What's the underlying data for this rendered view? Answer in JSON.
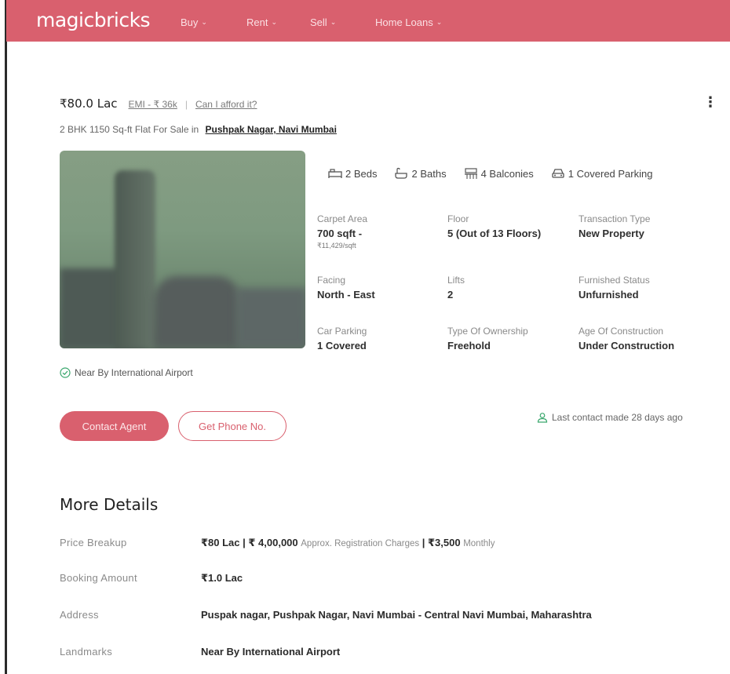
{
  "header": {
    "logo": "magicbricks",
    "nav": [
      {
        "label": "Buy"
      },
      {
        "label": "Rent"
      },
      {
        "label": "Sell"
      },
      {
        "label": "Home Loans"
      }
    ]
  },
  "listing": {
    "price": "₹80.0 Lac",
    "emi_link": "EMI - ₹ 36k",
    "separator": "|",
    "afford_link": "Can I afford it?",
    "subtitle_prefix": "2 BHK 1150 Sq-ft Flat For Sale in",
    "locality_link": "Pushpak Nagar, Navi Mumbai",
    "amenities": [
      {
        "icon": "bed-icon",
        "label": "2 Beds"
      },
      {
        "icon": "bath-icon",
        "label": "2 Baths"
      },
      {
        "icon": "balcony-icon",
        "label": "4 Balconies"
      },
      {
        "icon": "car-icon",
        "label": "1 Covered Parking"
      }
    ],
    "details": [
      {
        "label": "Carpet Area",
        "value": "700 sqft -",
        "sub": "₹11,429/sqft"
      },
      {
        "label": "Floor",
        "value": "5 (Out of 13 Floors)"
      },
      {
        "label": "Transaction Type",
        "value": "New Property"
      },
      {
        "label": "Facing",
        "value": "North - East"
      },
      {
        "label": "Lifts",
        "value": "2"
      },
      {
        "label": "Furnished Status",
        "value": "Unfurnished"
      },
      {
        "label": "Car Parking",
        "value": "1 Covered"
      },
      {
        "label": "Type Of Ownership",
        "value": "Freehold"
      },
      {
        "label": "Age Of Construction",
        "value": "Under Construction"
      }
    ],
    "nearby": "Near By International Airport",
    "contact_button": "Contact Agent",
    "phone_button": "Get Phone No.",
    "last_contact": "Last contact made 28 days ago"
  },
  "more_details": {
    "title": "More Details",
    "price_breakup_label": "Price Breakup",
    "price_breakup_price": "₹80 Lac | ₹ 4,00,000",
    "price_breakup_reg": "Approx. Registration Charges",
    "price_breakup_maint": "| ₹3,500",
    "price_breakup_monthly": "Monthly",
    "booking_label": "Booking Amount",
    "booking_value": "₹1.0 Lac",
    "address_label": "Address",
    "address_value": "Puspak nagar, Pushpak Nagar, Navi Mumbai - Central Navi Mumbai, Maharashtra",
    "landmarks_label": "Landmarks",
    "landmarks_value": "Near By International Airport"
  },
  "colors": {
    "brand": "#d9606e",
    "success": "#3aa76d"
  }
}
